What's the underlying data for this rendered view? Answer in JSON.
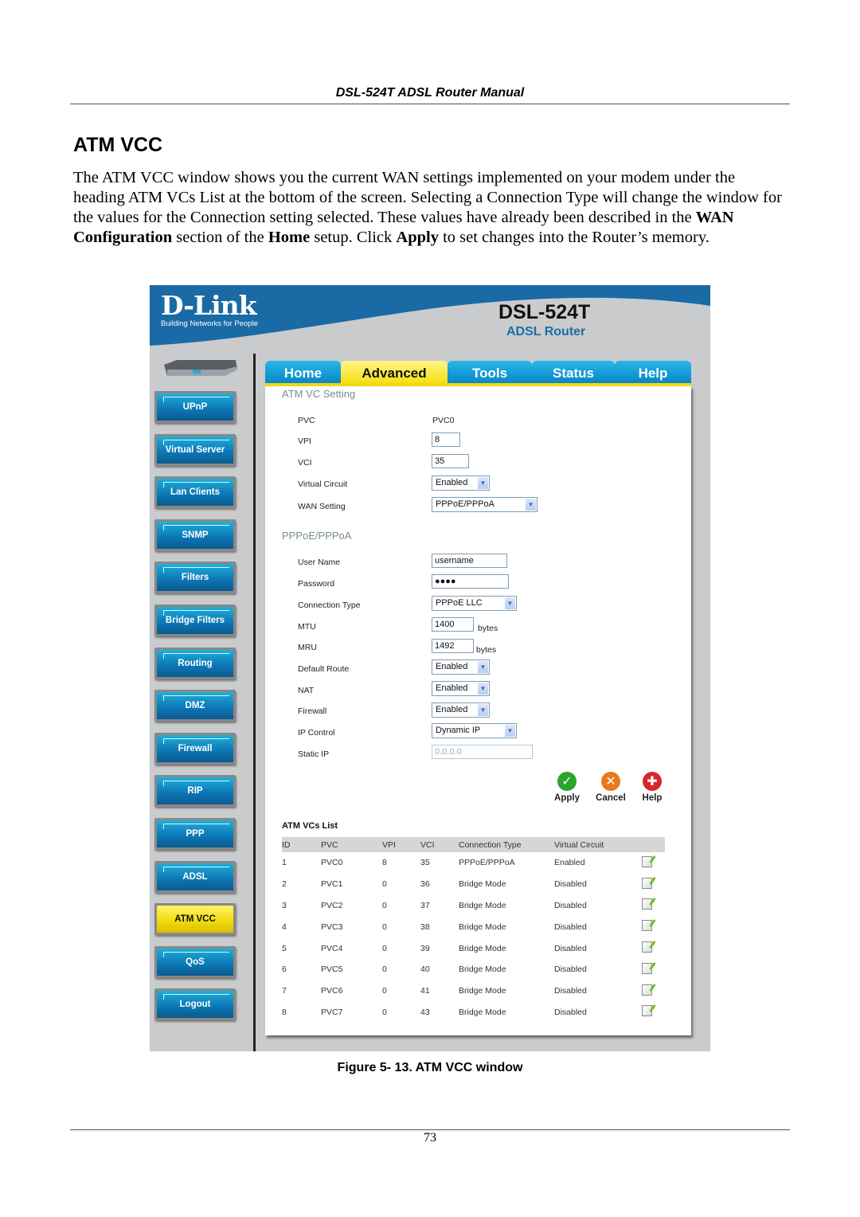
{
  "document": {
    "running_header": "DSL-524T ADSL Router Manual",
    "section_title": "ATM VCC",
    "paragraph": {
      "p1": "The ATM VCC window shows you the current WAN settings implemented on your modem under the heading ATM VCs List at the bottom of the screen. Selecting a Connection Type will change the window for the values for the Connection setting selected. These values have already been described in the ",
      "b1": "WAN Configuration",
      "p2": " section of the ",
      "b2": "Home",
      "p3": " setup. Click ",
      "b3": "Apply",
      "p4": " to set changes into the Router’s memory."
    },
    "figure_caption": "Figure 5- 13. ATM VCC window",
    "page_number": "73"
  },
  "router_ui": {
    "brand": {
      "logo": "D-Link",
      "tagline": "Building Networks for People",
      "model": "DSL-524T",
      "product": "ADSL Router",
      "brand_color": "#1a6aa6"
    },
    "tabs": [
      {
        "label": "Home",
        "active": false
      },
      {
        "label": "Advanced",
        "active": true
      },
      {
        "label": "Tools",
        "active": false
      },
      {
        "label": "Status",
        "active": false
      },
      {
        "label": "Help",
        "active": false
      }
    ],
    "sidebar": [
      {
        "label": "UPnP",
        "active": false
      },
      {
        "label": "Virtual Server",
        "active": false
      },
      {
        "label": "Lan Clients",
        "active": false
      },
      {
        "label": "SNMP",
        "active": false
      },
      {
        "label": "Filters",
        "active": false
      },
      {
        "label": "Bridge Filters",
        "active": false
      },
      {
        "label": "Routing",
        "active": false
      },
      {
        "label": "DMZ",
        "active": false
      },
      {
        "label": "Firewall",
        "active": false
      },
      {
        "label": "RIP",
        "active": false
      },
      {
        "label": "PPP",
        "active": false
      },
      {
        "label": "ADSL",
        "active": false
      },
      {
        "label": "ATM VCC",
        "active": true
      },
      {
        "label": "QoS",
        "active": false
      },
      {
        "label": "Logout",
        "active": false
      }
    ],
    "atm_vc_setting": {
      "heading": "ATM VC Setting",
      "pvc_label": "PVC",
      "pvc_value": "PVC0",
      "vpi_label": "VPI",
      "vpi_value": "8",
      "vci_label": "VCI",
      "vci_value": "35",
      "virtual_circuit_label": "Virtual Circuit",
      "virtual_circuit_value": "Enabled",
      "wan_setting_label": "WAN Setting",
      "wan_setting_value": "PPPoE/PPPoA"
    },
    "pppoe": {
      "heading": "PPPoE/PPPoA",
      "username_label": "User Name",
      "username_value": "username",
      "password_label": "Password",
      "password_value": "●●●●",
      "connection_type_label": "Connection Type",
      "connection_type_value": "PPPoE LLC",
      "mtu_label": "MTU",
      "mtu_value": "1400",
      "mtu_unit": "bytes",
      "mru_label": "MRU",
      "mru_value": "1492",
      "mru_unit": "bytes",
      "default_route_label": "Default Route",
      "default_route_value": "Enabled",
      "nat_label": "NAT",
      "nat_value": "Enabled",
      "firewall_label": "Firewall",
      "firewall_value": "Enabled",
      "ip_control_label": "IP Control",
      "ip_control_value": "Dynamic IP",
      "static_ip_label": "Static IP",
      "static_ip_value": "0.0.0.0"
    },
    "actions": {
      "apply": "Apply",
      "cancel": "Cancel",
      "help": "Help",
      "apply_color": "#2aa52a",
      "cancel_color": "#e8781e",
      "help_color": "#d9262b"
    },
    "vcs_list": {
      "title": "ATM VCs List",
      "columns": [
        "ID",
        "PVC",
        "VPI",
        "VCI",
        "Connection Type",
        "Virtual Circuit"
      ],
      "rows": [
        [
          "1",
          "PVC0",
          "8",
          "35",
          "PPPoE/PPPoA",
          "Enabled"
        ],
        [
          "2",
          "PVC1",
          "0",
          "36",
          "Bridge Mode",
          "Disabled"
        ],
        [
          "3",
          "PVC2",
          "0",
          "37",
          "Bridge Mode",
          "Disabled"
        ],
        [
          "4",
          "PVC3",
          "0",
          "38",
          "Bridge Mode",
          "Disabled"
        ],
        [
          "5",
          "PVC4",
          "0",
          "39",
          "Bridge Mode",
          "Disabled"
        ],
        [
          "6",
          "PVC5",
          "0",
          "40",
          "Bridge Mode",
          "Disabled"
        ],
        [
          "7",
          "PVC6",
          "0",
          "41",
          "Bridge Mode",
          "Disabled"
        ],
        [
          "8",
          "PVC7",
          "0",
          "43",
          "Bridge Mode",
          "Disabled"
        ]
      ]
    }
  }
}
